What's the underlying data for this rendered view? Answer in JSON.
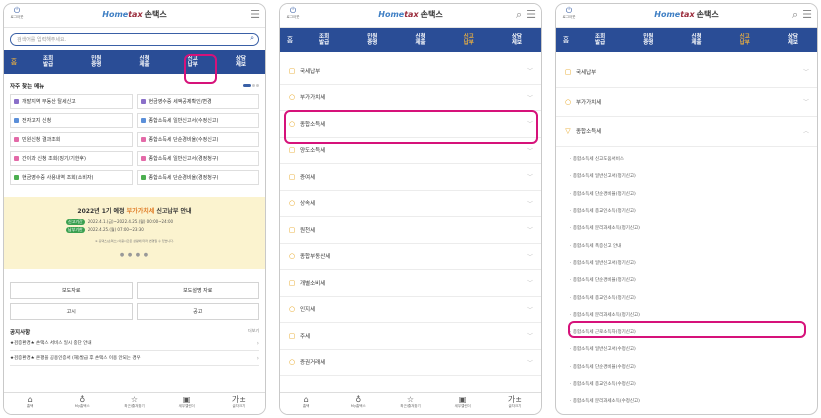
{
  "app": {
    "logo_home": "Home",
    "logo_tax": "tax",
    "logo_name": "손택스",
    "power_label": "로그아웃"
  },
  "screen1": {
    "search_placeholder": "검색어를 입력해주세요.",
    "nav_home": "홈",
    "nav": [
      "조회\n발급",
      "민원\n증명",
      "신청\n제출",
      "신고\n납부",
      "상담\n제보"
    ],
    "often_title": "자주 찾는 메뉴",
    "menu_items": [
      {
        "label": "개발지역 부동산 탈세신고",
        "color": "#8a6fc9"
      },
      {
        "label": "현금영수증 세액공제확인/변경",
        "color": "#8a6fc9"
      },
      {
        "label": "전자고지 신청",
        "color": "#5b8fd9"
      },
      {
        "label": "종합소득세 일반신고서(수정신고)",
        "color": "#5b8fd9"
      },
      {
        "label": "민원신청 결과조회",
        "color": "#e36aa8"
      },
      {
        "label": "종합소득세 단순경비율(수정신고)",
        "color": "#e36aa8"
      },
      {
        "label": "간이과 신청 조회(징기/기한후)",
        "color": "#e36aa8"
      },
      {
        "label": "종합소득세 일반신고서(경정청구)",
        "color": "#e36aa8"
      },
      {
        "label": "현금영수증 사용내역 조회(소비자)",
        "color": "#4caf50"
      },
      {
        "label": "종합소득세 단순경비율(경정청구)",
        "color": "#4caf50"
      }
    ],
    "banner": {
      "title_pre": "2022년 1기 예정",
      "title_hl": "부가가치세",
      "title_post": "신고납부 안내",
      "row1_badge": "신고기간",
      "row1_text": "2022.4.1.(금)~2022.4.25.(월) 00:00~24:00",
      "row2_badge": "납부기한",
      "row2_text": "2022.4.25.(월) 07:00~23:30",
      "note": "※ 홈택스(손택스) 이용시간은 상황에 따라 변경될 수 있습니다.",
      "dots": "● ● ● ●"
    },
    "buttons": [
      "보도자료",
      "보도설명 자료",
      "고시",
      "공고"
    ],
    "notice_title": "공지사항",
    "notice_more": "더보기",
    "notices": [
      "★검증환경★ 손택스 서비스 일시 중단 안내",
      "★검증환경★ 온평을 공용인증서 (재)발급 후 손택스 이용 안되는 경우"
    ]
  },
  "bottom_nav": [
    {
      "icon": "⌂",
      "label": "홈택"
    },
    {
      "icon": "♁",
      "label": "My홈택스"
    },
    {
      "icon": "☆",
      "label": "최근/즐겨찾기"
    },
    {
      "icon": "▣",
      "label": "세무캘린더"
    },
    {
      "icon": "가±",
      "label": "글자크기"
    }
  ],
  "screen2": {
    "items": [
      {
        "label": "국세납부",
        "icon": "▢"
      },
      {
        "label": "부가가치세",
        "icon": "○"
      },
      {
        "label": "종합소득세",
        "icon": "○"
      },
      {
        "label": "양도소득세",
        "icon": "▢"
      },
      {
        "label": "증여세",
        "icon": "▢"
      },
      {
        "label": "상속세",
        "icon": "○"
      },
      {
        "label": "원천세",
        "icon": "▢"
      },
      {
        "label": "종합부동산세",
        "icon": "○"
      },
      {
        "label": "개별소비세",
        "icon": "▢"
      },
      {
        "label": "인지세",
        "icon": "○"
      },
      {
        "label": "주세",
        "icon": "▢"
      },
      {
        "label": "증권거래세",
        "icon": "○"
      }
    ]
  },
  "screen3": {
    "items": [
      {
        "label": "국세납부",
        "icon": "▢"
      },
      {
        "label": "부가가치세",
        "icon": "○"
      },
      {
        "label": "종합소득세",
        "icon": "▽"
      }
    ],
    "subs": [
      "· 종합소득세 신고도움서비스",
      "· 종합소득세 일반신고서(정기신고)",
      "· 종합소득세 단순경비율(정기신고)",
      "· 종합소득세 종교인소득(정기신고)",
      "· 종합소득세 분리과세소득(정기신고)",
      "· 종합소득세 폭증신고 안내",
      "· 종합소득세 일반신고서(정기신고)",
      "· 종합소득세 단순경비율(정기신고)",
      "· 종합소득세 종교인소득(정기신고)",
      "· 종합소득세 분리과세소득(정기신고)",
      "· 종합소득세 근로소득자(정기신고)",
      "· 종합소득세 일반신고서(수정신고)",
      "· 종합소득세 단순경비율(수정신고)",
      "· 종합소득세 종교인소득(수정신고)",
      "· 종합소득세 분리과세소득(수정신고)"
    ]
  },
  "colors": {
    "nav": "#2a4d96",
    "highlight": "#d6127a",
    "accent": "#f2b33c"
  }
}
